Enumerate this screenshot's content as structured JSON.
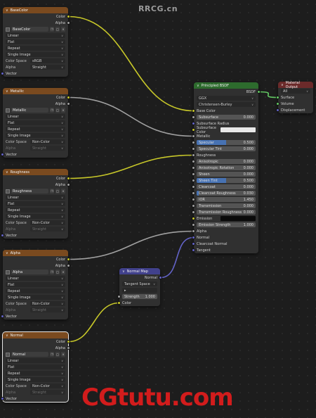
{
  "watermark_top": "RRCG.cn",
  "watermark_bottom": "CGtutu.com",
  "colors": {
    "link_color": "#c7c729",
    "link_float": "#a1a1a1",
    "link_vector": "#6363c7",
    "link_shader": "#63c763",
    "texture_header": "#7a4a1f",
    "vector_header": "#41418c",
    "shader_header": "#2d6b2d",
    "output_header": "#6b2a2a",
    "slider_fill": "#4772b3"
  },
  "tex_nodes": [
    {
      "title": "BaseColor",
      "image": "BaseColor",
      "outputs": [
        "Color",
        "Alpha"
      ],
      "interpolation": "Linear",
      "projection": "Flat",
      "extension": "Repeat",
      "source": "Single Image",
      "colorspace_label": "Color Space",
      "colorspace": "sRGB",
      "alpha_label": "Alpha",
      "alpha": "Straight",
      "alpha_dim": false,
      "vector": "Vector",
      "selected": false
    },
    {
      "title": "Metallic",
      "image": "Metallic",
      "outputs": [
        "Color",
        "Alpha"
      ],
      "interpolation": "Linear",
      "projection": "Flat",
      "extension": "Repeat",
      "source": "Single Image",
      "colorspace_label": "Color Space",
      "colorspace": "Non-Color",
      "alpha_label": "Alpha",
      "alpha": "Straight",
      "alpha_dim": true,
      "vector": "Vector",
      "selected": false
    },
    {
      "title": "Roughness",
      "image": "Roughness",
      "outputs": [
        "Color",
        "Alpha"
      ],
      "interpolation": "Linear",
      "projection": "Flat",
      "extension": "Repeat",
      "source": "Single Image",
      "colorspace_label": "Color Space",
      "colorspace": "Non-Color",
      "alpha_label": "Alpha",
      "alpha": "Straight",
      "alpha_dim": true,
      "vector": "Vector",
      "selected": false
    },
    {
      "title": "Alpha",
      "image": "Alpha",
      "outputs": [
        "Color",
        "Alpha"
      ],
      "interpolation": "Linear",
      "projection": "Flat",
      "extension": "Repeat",
      "source": "Single Image",
      "colorspace_label": "Color Space",
      "colorspace": "Non-Color",
      "alpha_label": "Alpha",
      "alpha": "Straight",
      "alpha_dim": true,
      "vector": "Vector",
      "selected": false
    },
    {
      "title": "Normal",
      "image": "Normal",
      "outputs": [
        "Color",
        "Alpha"
      ],
      "interpolation": "Linear",
      "projection": "Flat",
      "extension": "Repeat",
      "source": "Single Image",
      "colorspace_label": "Color Space",
      "colorspace": "Non-Color",
      "alpha_label": "Alpha",
      "alpha": "Straight",
      "alpha_dim": true,
      "vector": "Vector",
      "selected": true
    }
  ],
  "normal_map": {
    "title": "Normal Map",
    "output": "Normal",
    "space": "Tangent Space",
    "uvmap": "",
    "strength_label": "Strength",
    "strength": "1.000",
    "input": "Color"
  },
  "bsdf": {
    "title": "Principled BSDF",
    "output": "BSDF",
    "distribution": "GGX",
    "subsurface_method": "Christensen-Burley",
    "base_color": "Base Color",
    "subsurface": {
      "label": "Subsurface",
      "value": "0.000",
      "fill": 0
    },
    "subsurface_radius": "Subsurface Radius",
    "subsurface_color": {
      "label": "Subsurface Color",
      "swatch": "#e8e8e8"
    },
    "metallic": "Metallic",
    "specular": {
      "label": "Specular",
      "value": "0.500",
      "fill": 0.5
    },
    "specular_tint": {
      "label": "Specular Tint",
      "value": "0.000",
      "fill": 0
    },
    "roughness": "Roughness",
    "sliders": [
      {
        "label": "Anisotropic",
        "value": "0.000",
        "fill": 0
      },
      {
        "label": "Anisotropic Rotation",
        "value": "0.000",
        "fill": 0
      },
      {
        "label": "Sheen",
        "value": "0.000",
        "fill": 0
      },
      {
        "label": "Sheen Tint",
        "value": "0.500",
        "fill": 0.5
      },
      {
        "label": "Clearcoat",
        "value": "0.000",
        "fill": 0
      },
      {
        "label": "Clearcoat Roughness",
        "value": "0.030",
        "fill": 0.03
      },
      {
        "label": "IOR",
        "value": "1.450",
        "fill": 0
      },
      {
        "label": "Transmission",
        "value": "0.000",
        "fill": 0
      },
      {
        "label": "Transmission Roughness",
        "value": "0.000",
        "fill": 0
      }
    ],
    "emission": {
      "label": "Emission",
      "swatch": "#0a0a0a"
    },
    "emission_strength": {
      "label": "Emission Strength",
      "value": "1.000",
      "fill": 0
    },
    "alpha": "Alpha",
    "normal": "Normal",
    "clearcoat_normal": "Clearcoat Normal",
    "tangent": "Tangent"
  },
  "output_node": {
    "title": "Material Output",
    "target": "All",
    "inputs": [
      "Surface",
      "Volume",
      "Displacement"
    ]
  }
}
